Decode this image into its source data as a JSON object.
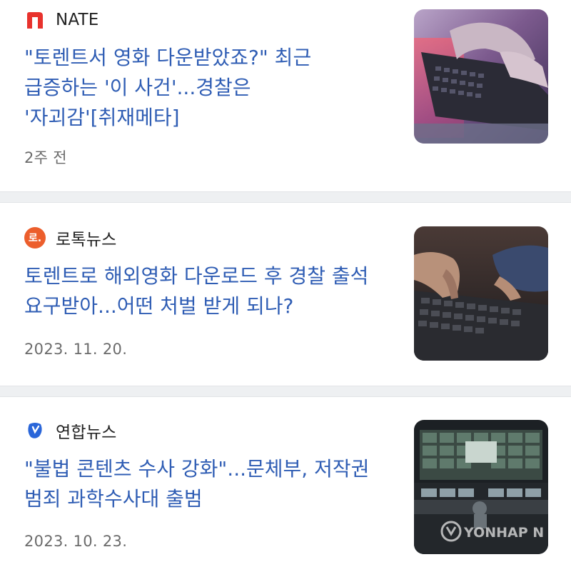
{
  "articles": [
    {
      "source": "NATE",
      "source_logo": "nate-logo-icon",
      "headline": "\"토렌트서 영화 다운받았죠?\" 최근 급증하는 '이 사건'...경찰은 '자괴감'[취재메타]",
      "date": "2주 전",
      "thumbnail": "laptop-keyboard-photo"
    },
    {
      "source": "로톡뉴스",
      "source_logo": "lawtalk-news-logo-icon",
      "logo_text": "로.",
      "headline": "토렌트로 해외영화 다운로드 후 경찰 출석 요구받아...어떤 처벌 받게 되나?",
      "date": "2023. 11. 20.",
      "thumbnail": "typing-on-laptop-photo"
    },
    {
      "source": "연합뉴스",
      "source_logo": "yonhap-news-logo-icon",
      "headline": "\"불법 콘텐츠 수사 강화\"...문체부, 저작권 범죄 과학수사대 출범",
      "date": "2023. 10. 23.",
      "thumbnail": "control-room-photo",
      "watermark": "YONHAP N"
    }
  ],
  "colors": {
    "headline": "#2f5db4",
    "nate_brand": "#e8322d",
    "lawtalk_brand": "#ec5e2c",
    "yonhap_brand": "#2a66d9",
    "separator": "#eef0f2"
  }
}
